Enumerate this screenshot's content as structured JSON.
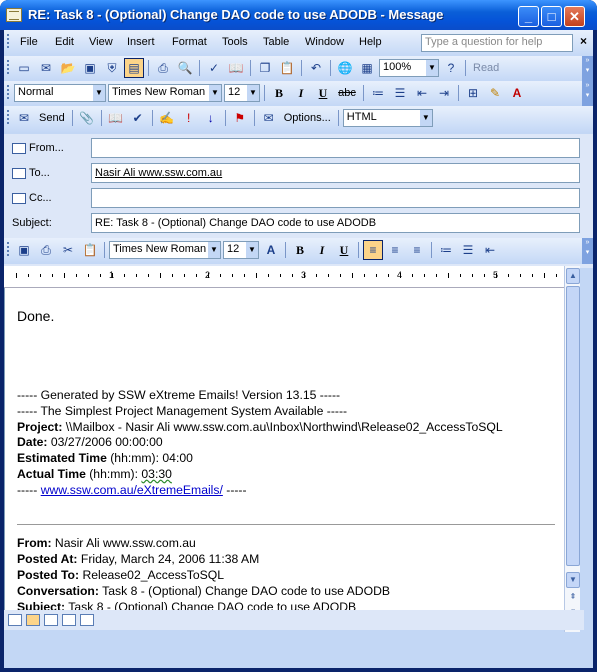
{
  "window": {
    "title": "RE: Task 8 - (Optional) Change DAO code to use ADODB - Message",
    "minimize": "_",
    "maximize": "□",
    "close": "✕"
  },
  "menu": {
    "items": [
      "File",
      "Edit",
      "View",
      "Insert",
      "Format",
      "Tools",
      "Table",
      "Window",
      "Help"
    ],
    "help_placeholder": "Type a question for help",
    "close_doc": "×"
  },
  "std_toolbar": {
    "zoom": "100%",
    "read": "Read"
  },
  "fmt_toolbar": {
    "style": "Normal",
    "font": "Times New Roman",
    "size": "12",
    "bold": "B",
    "italic": "I",
    "underline": "U",
    "strike": "abc"
  },
  "mail_toolbar": {
    "send": "Send",
    "options": "Options...",
    "format": "HTML"
  },
  "address": {
    "from_label": "From...",
    "from_value": "",
    "to_label": "To...",
    "to_value": "Nasir Ali www.ssw.com.au",
    "cc_label": "Cc...",
    "cc_value": "",
    "subject_label": "Subject:",
    "subject_value": "RE: Task 8 - (Optional) Change DAO code to use ADODB"
  },
  "edit_toolbar": {
    "font": "Times New Roman",
    "size": "12",
    "bold": "B",
    "italic": "I",
    "underline": "U"
  },
  "ruler": {
    "numbers": [
      "1",
      "2",
      "3",
      "4",
      "5"
    ]
  },
  "body": {
    "reply": "Done.",
    "gen_line": "----- Generated by SSW eXtreme Emails! Version 13.15 -----",
    "tag_line": "----- The Simplest Project Management System Available -----",
    "project_label": "Project:",
    "project_value": " \\\\Mailbox - Nasir Ali www.ssw.com.au\\Inbox\\Northwind\\Release02_AccessToSQL",
    "date_label": "Date:",
    "date_value": " 03/27/2006 00:00:00",
    "est_label": "Estimated Time",
    "est_value": " (hh:mm): 04:00",
    "actual_label": "Actual Time",
    "actual_prefix": " (hh:mm): ",
    "actual_value": "03:30",
    "link_prefix": "----- ",
    "link_text": "www.ssw.com.au/eXtremeEmails/",
    "link_suffix": " -----",
    "from_label": "From:",
    "from_value": " Nasir Ali www.ssw.com.au",
    "posted_at_label": "Posted At:",
    "posted_at_value": " Friday, March 24, 2006 11:38 AM",
    "posted_to_label": "Posted To:",
    "posted_to_value": " Release02_AccessToSQL",
    "conv_label": "Conversation:",
    "conv_value": " Task 8 - (Optional) Change DAO code to use ADODB",
    "subj_label": "Subject:",
    "subj_value": " Task 8 - (Optional) Change DAO code to use ADODB"
  }
}
